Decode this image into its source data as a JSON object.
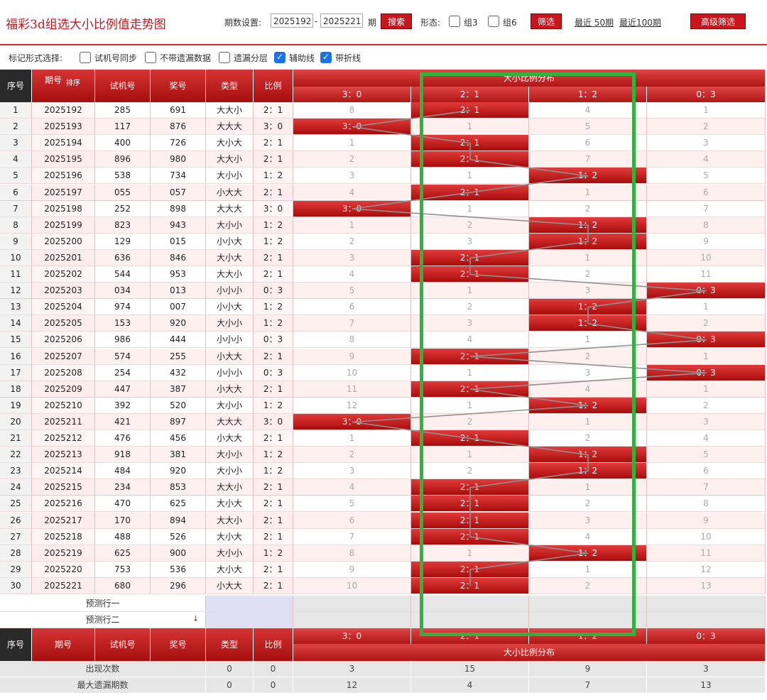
{
  "header": {
    "title": "福彩3d组选大小比例值走势图",
    "period_label": "期数设置:",
    "period_from": "2025192",
    "period_dash": "-",
    "period_to": "2025221",
    "period_unit": "期",
    "search_button": "搜索",
    "form_label": "形态:",
    "group3_label": "组3",
    "group6_label": "组6",
    "filter_button": "筛选",
    "recent50_link": "最近 50期",
    "recent100_link": "最近100期",
    "advanced_button": "高级筛选"
  },
  "options": {
    "label": "标记形式选择:",
    "items": [
      {
        "label": "试机号同步",
        "checked": false
      },
      {
        "label": "不带遗漏数据",
        "checked": false
      },
      {
        "label": "遗漏分层",
        "checked": false
      },
      {
        "label": "辅助线",
        "checked": true
      },
      {
        "label": "带折线",
        "checked": true
      }
    ]
  },
  "table": {
    "col_headers": {
      "seq": "序号",
      "period": "期号",
      "sort": "排序",
      "test": "试机号",
      "prize": "奖号",
      "type": "类型",
      "ratio": "比例"
    },
    "dist_header": "大小比例分布",
    "ratios": [
      "3：0",
      "2：1",
      "1：2",
      "0：3"
    ],
    "rows": [
      {
        "seq": "1",
        "period": "2025192",
        "test": "285",
        "prize": "691",
        "type": "大大小",
        "ratio": "2：1",
        "hit": 1,
        "cells": [
          "8",
          "2：1",
          "4",
          "1"
        ]
      },
      {
        "seq": "2",
        "period": "2025193",
        "test": "117",
        "prize": "876",
        "type": "大大大",
        "ratio": "3：0",
        "hit": 0,
        "cells": [
          "3：0",
          "1",
          "5",
          "2"
        ]
      },
      {
        "seq": "3",
        "period": "2025194",
        "test": "400",
        "prize": "726",
        "type": "大小大",
        "ratio": "2：1",
        "hit": 1,
        "cells": [
          "1",
          "2：1",
          "6",
          "3"
        ]
      },
      {
        "seq": "4",
        "period": "2025195",
        "test": "896",
        "prize": "980",
        "type": "大大小",
        "ratio": "2：1",
        "hit": 1,
        "cells": [
          "2",
          "2：1",
          "7",
          "4"
        ]
      },
      {
        "seq": "5",
        "period": "2025196",
        "test": "538",
        "prize": "734",
        "type": "大小小",
        "ratio": "1：2",
        "hit": 2,
        "cells": [
          "3",
          "1",
          "1：2",
          "5"
        ]
      },
      {
        "seq": "6",
        "period": "2025197",
        "test": "055",
        "prize": "057",
        "type": "小大大",
        "ratio": "2：1",
        "hit": 1,
        "cells": [
          "4",
          "2：1",
          "1",
          "6"
        ]
      },
      {
        "seq": "7",
        "period": "2025198",
        "test": "252",
        "prize": "898",
        "type": "大大大",
        "ratio": "3：0",
        "hit": 0,
        "cells": [
          "3：0",
          "1",
          "2",
          "7"
        ]
      },
      {
        "seq": "8",
        "period": "2025199",
        "test": "823",
        "prize": "943",
        "type": "大小小",
        "ratio": "1：2",
        "hit": 2,
        "cells": [
          "1",
          "2",
          "1：2",
          "8"
        ]
      },
      {
        "seq": "9",
        "period": "2025200",
        "test": "129",
        "prize": "015",
        "type": "小小大",
        "ratio": "1：2",
        "hit": 2,
        "cells": [
          "2",
          "3",
          "1：2",
          "9"
        ]
      },
      {
        "seq": "10",
        "period": "2025201",
        "test": "636",
        "prize": "846",
        "type": "大小大",
        "ratio": "2：1",
        "hit": 1,
        "cells": [
          "3",
          "2：1",
          "1",
          "10"
        ]
      },
      {
        "seq": "11",
        "period": "2025202",
        "test": "544",
        "prize": "953",
        "type": "大大小",
        "ratio": "2：1",
        "hit": 1,
        "cells": [
          "4",
          "2：1",
          "2",
          "11"
        ]
      },
      {
        "seq": "12",
        "period": "2025203",
        "test": "034",
        "prize": "013",
        "type": "小小小",
        "ratio": "0：3",
        "hit": 3,
        "cells": [
          "5",
          "1",
          "3",
          "0：3"
        ]
      },
      {
        "seq": "13",
        "period": "2025204",
        "test": "974",
        "prize": "007",
        "type": "小小大",
        "ratio": "1：2",
        "hit": 2,
        "cells": [
          "6",
          "2",
          "1：2",
          "1"
        ]
      },
      {
        "seq": "14",
        "period": "2025205",
        "test": "153",
        "prize": "920",
        "type": "大小小",
        "ratio": "1：2",
        "hit": 2,
        "cells": [
          "7",
          "3",
          "1：2",
          "2"
        ]
      },
      {
        "seq": "15",
        "period": "2025206",
        "test": "986",
        "prize": "444",
        "type": "小小小",
        "ratio": "0：3",
        "hit": 3,
        "cells": [
          "8",
          "4",
          "1",
          "0：3"
        ]
      },
      {
        "seq": "16",
        "period": "2025207",
        "test": "574",
        "prize": "255",
        "type": "小大大",
        "ratio": "2：1",
        "hit": 1,
        "cells": [
          "9",
          "2：1",
          "2",
          "1"
        ]
      },
      {
        "seq": "17",
        "period": "2025208",
        "test": "254",
        "prize": "432",
        "type": "小小小",
        "ratio": "0：3",
        "hit": 3,
        "cells": [
          "10",
          "1",
          "3",
          "0：3"
        ]
      },
      {
        "seq": "18",
        "period": "2025209",
        "test": "447",
        "prize": "387",
        "type": "小大大",
        "ratio": "2：1",
        "hit": 1,
        "cells": [
          "11",
          "2：1",
          "4",
          "1"
        ]
      },
      {
        "seq": "19",
        "period": "2025210",
        "test": "392",
        "prize": "520",
        "type": "大小小",
        "ratio": "1：2",
        "hit": 2,
        "cells": [
          "12",
          "1",
          "1：2",
          "2"
        ]
      },
      {
        "seq": "20",
        "period": "2025211",
        "test": "421",
        "prize": "897",
        "type": "大大大",
        "ratio": "3：0",
        "hit": 0,
        "cells": [
          "3：0",
          "2",
          "1",
          "3"
        ]
      },
      {
        "seq": "21",
        "period": "2025212",
        "test": "476",
        "prize": "456",
        "type": "小大大",
        "ratio": "2：1",
        "hit": 1,
        "cells": [
          "1",
          "2：1",
          "2",
          "4"
        ]
      },
      {
        "seq": "22",
        "period": "2025213",
        "test": "918",
        "prize": "381",
        "type": "大小小",
        "ratio": "1：2",
        "hit": 2,
        "cells": [
          "2",
          "1",
          "1：2",
          "5"
        ]
      },
      {
        "seq": "23",
        "period": "2025214",
        "test": "484",
        "prize": "920",
        "type": "大小小",
        "ratio": "1：2",
        "hit": 2,
        "cells": [
          "3",
          "2",
          "1：2",
          "6"
        ]
      },
      {
        "seq": "24",
        "period": "2025215",
        "test": "234",
        "prize": "853",
        "type": "大大小",
        "ratio": "2：1",
        "hit": 1,
        "cells": [
          "4",
          "2：1",
          "1",
          "7"
        ]
      },
      {
        "seq": "25",
        "period": "2025216",
        "test": "470",
        "prize": "625",
        "type": "大小大",
        "ratio": "2：1",
        "hit": 1,
        "cells": [
          "5",
          "2：1",
          "2",
          "8"
        ]
      },
      {
        "seq": "26",
        "period": "2025217",
        "test": "170",
        "prize": "894",
        "type": "大大小",
        "ratio": "2：1",
        "hit": 1,
        "cells": [
          "6",
          "2：1",
          "3",
          "9"
        ]
      },
      {
        "seq": "27",
        "period": "2025218",
        "test": "488",
        "prize": "526",
        "type": "大小大",
        "ratio": "2：1",
        "hit": 1,
        "cells": [
          "7",
          "2：1",
          "4",
          "10"
        ]
      },
      {
        "seq": "28",
        "period": "2025219",
        "test": "625",
        "prize": "900",
        "type": "大小小",
        "ratio": "1：2",
        "hit": 2,
        "cells": [
          "8",
          "1",
          "1：2",
          "11"
        ]
      },
      {
        "seq": "29",
        "period": "2025220",
        "test": "753",
        "prize": "536",
        "type": "大小大",
        "ratio": "2：1",
        "hit": 1,
        "cells": [
          "9",
          "2：1",
          "1",
          "12"
        ]
      },
      {
        "seq": "30",
        "period": "2025221",
        "test": "680",
        "prize": "296",
        "type": "小大大",
        "ratio": "2：1",
        "hit": 1,
        "cells": [
          "10",
          "2：1",
          "2",
          "13"
        ]
      }
    ],
    "predict": [
      "预测行一",
      "预测行二"
    ],
    "stats": [
      {
        "label": "出现次数",
        "type": "0",
        "ratio": "0",
        "cells": [
          "3",
          "15",
          "9",
          "3"
        ]
      },
      {
        "label": "最大遗漏期数",
        "type": "0",
        "ratio": "0",
        "cells": [
          "12",
          "4",
          "7",
          "13"
        ]
      }
    ]
  },
  "colors": {
    "brand_red": "#c8161e",
    "highlight_green": "#2fb33e"
  }
}
